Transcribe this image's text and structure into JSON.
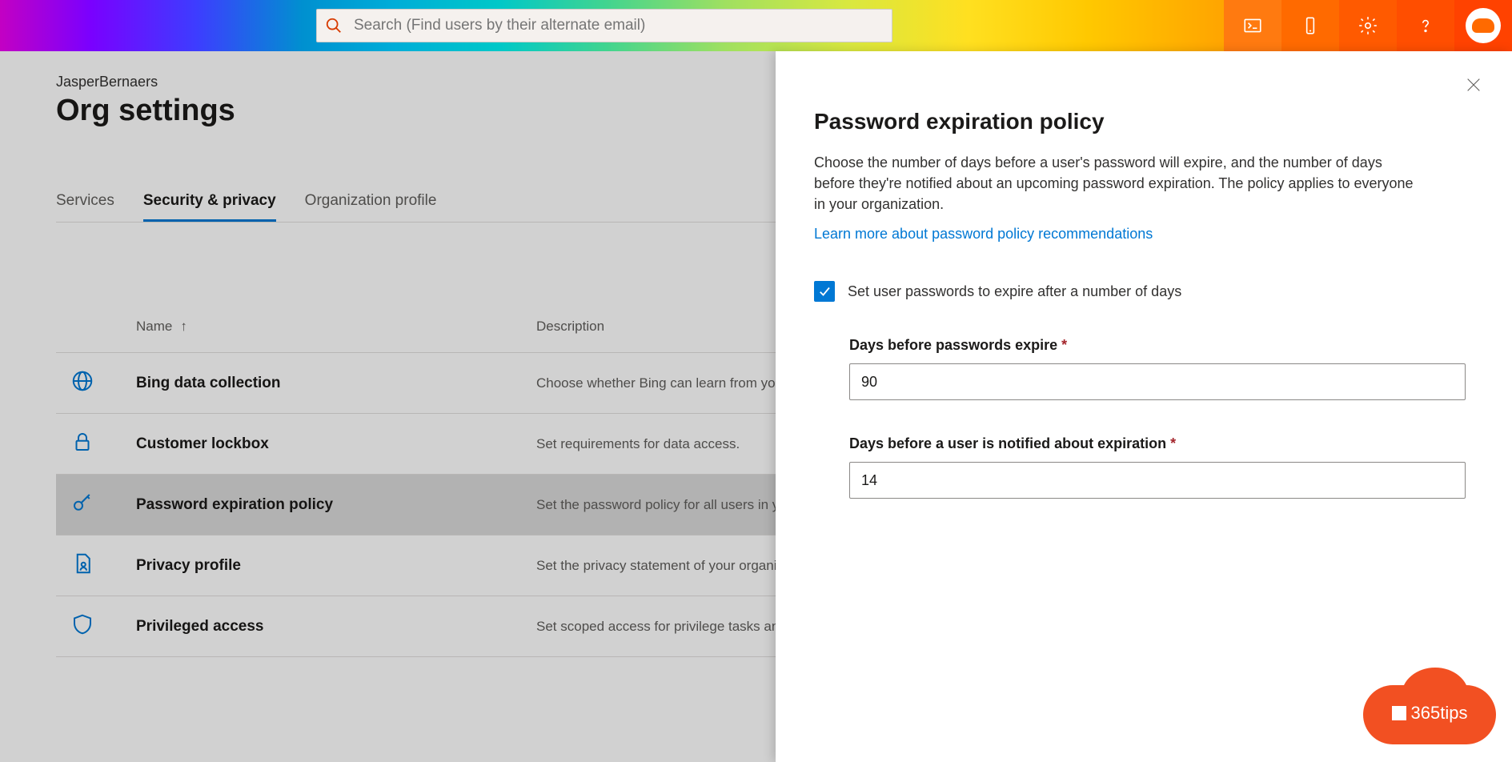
{
  "search": {
    "placeholder": "Search (Find users by their alternate email)"
  },
  "breadcrumb": "JasperBernaers",
  "page_title": "Org settings",
  "tabs": [
    {
      "label": "Services",
      "active": false
    },
    {
      "label": "Security & privacy",
      "active": true
    },
    {
      "label": "Organization profile",
      "active": false
    }
  ],
  "columns": {
    "name": "Name",
    "description": "Description"
  },
  "rows": [
    {
      "icon": "globe",
      "name": "Bing data collection",
      "desc": "Choose whether Bing can learn from your or",
      "selected": false
    },
    {
      "icon": "lock",
      "name": "Customer lockbox",
      "desc": "Set requirements for data access.",
      "selected": false
    },
    {
      "icon": "key",
      "name": "Password expiration policy",
      "desc": "Set the password policy for all users in your",
      "selected": true
    },
    {
      "icon": "doc-person",
      "name": "Privacy profile",
      "desc": "Set the privacy statement of your organizati",
      "selected": false
    },
    {
      "icon": "shield",
      "name": "Privileged access",
      "desc": "Set scoped access for privilege tasks and dat",
      "selected": false
    }
  ],
  "panel": {
    "title": "Password expiration policy",
    "description": "Choose the number of days before a user's password will expire, and the number of days before they're notified about an upcoming password expiration. The policy applies to everyone in your organization.",
    "link": "Learn more about password policy recommendations",
    "checkbox_label": "Set user passwords to expire after a number of days",
    "checkbox_checked": true,
    "fields": {
      "expire_label": "Days before passwords expire",
      "expire_value": "90",
      "notify_label": "Days before a user is notified about expiration",
      "notify_value": "14"
    }
  },
  "logo_text": "365tips"
}
